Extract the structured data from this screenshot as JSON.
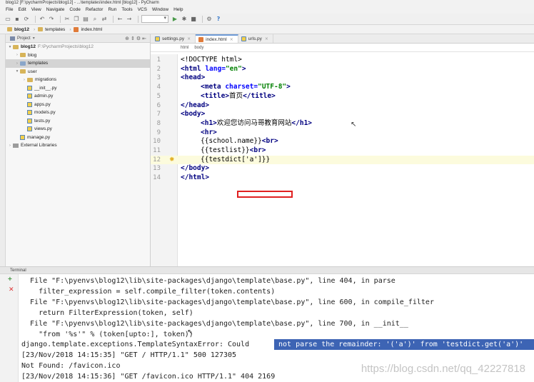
{
  "window_title": "blog12 [F:\\pycharmProjects\\blog12] - ...\\templates\\index.html [blog12] - PyCharm",
  "menu": [
    "File",
    "Edit",
    "View",
    "Navigate",
    "Code",
    "Refactor",
    "Run",
    "Tools",
    "VCS",
    "Window",
    "Help"
  ],
  "breadcrumbs": [
    "blog12",
    "templates",
    "index.html"
  ],
  "project_panel": {
    "title": "Project",
    "tree": [
      {
        "label": "blog12",
        "suffix": "F:\\PycharmProjects\\blog12",
        "kind": "folder",
        "expanded": true
      },
      {
        "label": "blog",
        "kind": "folder",
        "expanded": false
      },
      {
        "label": "templates",
        "kind": "folder",
        "expanded": false,
        "selected": true
      },
      {
        "label": "user",
        "kind": "folder",
        "expanded": true
      },
      {
        "label": "migrations",
        "kind": "folder",
        "expanded": false
      },
      {
        "label": "__init__.py",
        "kind": "py"
      },
      {
        "label": "admin.py",
        "kind": "py"
      },
      {
        "label": "apps.py",
        "kind": "py"
      },
      {
        "label": "models.py",
        "kind": "py"
      },
      {
        "label": "tests.py",
        "kind": "py"
      },
      {
        "label": "views.py",
        "kind": "py"
      },
      {
        "label": "manage.py",
        "kind": "py"
      },
      {
        "label": "External Libraries",
        "kind": "lib",
        "expanded": false
      }
    ]
  },
  "editor": {
    "tabs": [
      {
        "label": "settings.py",
        "kind": "py",
        "active": false
      },
      {
        "label": "index.html",
        "kind": "html",
        "active": true
      },
      {
        "label": "urls.py",
        "kind": "py",
        "active": false
      }
    ],
    "path_crumbs": [
      "html",
      "body"
    ],
    "line_numbers": [
      "1",
      "2",
      "3",
      "4",
      "5",
      "6",
      "7",
      "8",
      "9",
      "10",
      "11",
      "12",
      "13",
      "14"
    ],
    "code_text": {
      "l1": "<!DOCTYPE html>",
      "l2_tag": "<html ",
      "l2_attr": "lang=",
      "l2_str": "\"en\"",
      "l2_end": ">",
      "l3": "<head>",
      "l4_tag": "<meta ",
      "l4_attr": "charset=",
      "l4_str": "\"UTF-8\"",
      "l4_end": ">",
      "l5_open": "<title>",
      "l5_text": "首页",
      "l5_close": "</title>",
      "l6": "</head>",
      "l7": "<body>",
      "l8_open": "<h1>",
      "l8_text": "欢迎您访问马哥教育网站",
      "l8_close": "</h1>",
      "l9": "<hr>",
      "l10_text": "{{school.name}}",
      "l10_tag": "<br>",
      "l11_text": "{{testlist}}",
      "l11_tag": "<br>",
      "l12_text": "{{testdict['a']}}",
      "l13": "</body>",
      "l14": "</html>"
    }
  },
  "terminal": {
    "title": "Terminal",
    "lines": [
      "  File \"F:\\pyenvs\\blog12\\lib\\site-packages\\django\\template\\base.py\", line 404, in parse",
      "    filter_expression = self.compile_filter(token.contents)",
      "  File \"F:\\pyenvs\\blog12\\lib\\site-packages\\django\\template\\base.py\", line 600, in compile_filter",
      "    return FilterExpression(token, self)",
      "  File \"F:\\pyenvs\\blog12\\lib\\site-packages\\django\\template\\base.py\", line 700, in __init__",
      "    \"from '%s'\" % (token[upto:], token))",
      "django.template.exceptions.TemplateSyntaxError: Could",
      "[23/Nov/2018 14:15:35] \"GET / HTTP/1.1\" 500 127305",
      "Not Found: /favicon.ico",
      "[23/Nov/2018 14:15:36] \"GET /favicon.ico HTTP/1.1\" 404 2169"
    ],
    "selected_text": "not parse the remainder: '('a')' from 'testdict.get('a')'"
  },
  "watermark": "https://blog.csdn.net/qq_42227818"
}
